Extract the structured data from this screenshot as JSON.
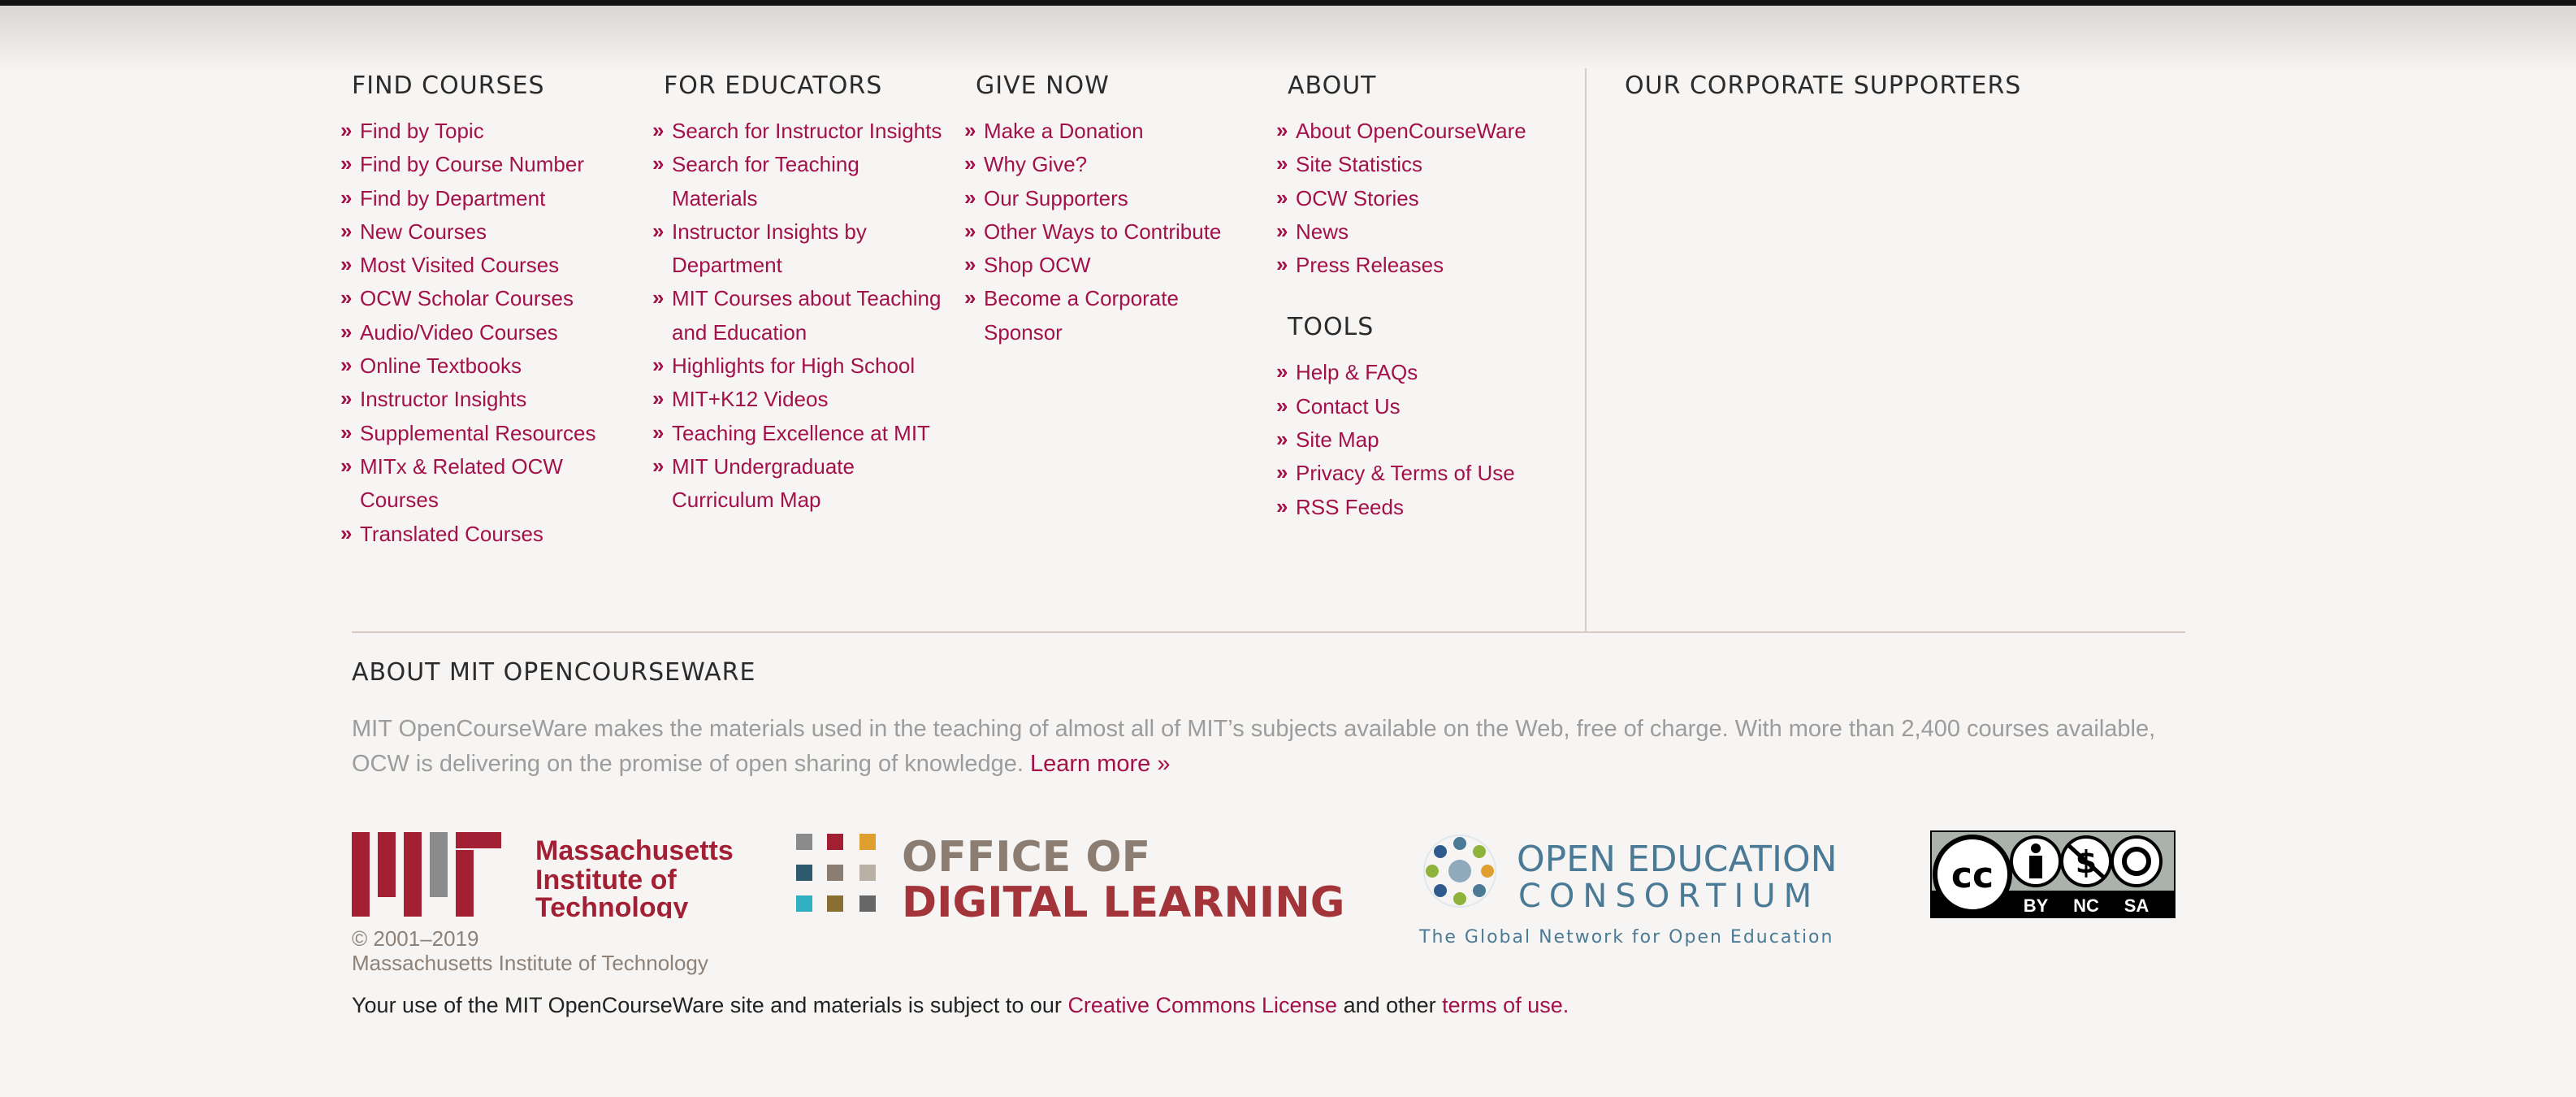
{
  "columns": {
    "find_courses": {
      "title": "FIND COURSES",
      "items": [
        "Find by Topic",
        "Find by Course Number",
        "Find by Department",
        "New Courses",
        "Most Visited Courses",
        "OCW Scholar Courses",
        "Audio/Video Courses",
        "Online Textbooks",
        "Instructor Insights",
        "Supplemental Resources",
        "MITx & Related OCW",
        "Courses",
        "Translated Courses"
      ]
    },
    "for_educators": {
      "title": "FOR EDUCATORS",
      "items": [
        "Search for Instructor Insights",
        "Search for Teaching",
        "Materials",
        "Instructor Insights by",
        "Department",
        "MIT Courses about Teaching",
        "and Education",
        "Highlights for High School",
        "MIT+K12 Videos",
        "Teaching Excellence at MIT",
        "MIT Undergraduate",
        "Curriculum Map"
      ]
    },
    "give_now": {
      "title": "GIVE NOW",
      "items": [
        "Make a Donation",
        "Why Give?",
        "Our Supporters",
        "Other Ways to Contribute",
        "Shop OCW",
        "Become a Corporate",
        "Sponsor"
      ]
    },
    "about": {
      "title": "ABOUT",
      "items": [
        "About OpenCourseWare",
        "Site Statistics",
        "OCW Stories",
        "News",
        "Press Releases"
      ]
    },
    "tools": {
      "title": "TOOLS",
      "items": [
        "Help & FAQs",
        "Contact Us",
        "Site Map",
        "Privacy & Terms of Use",
        "RSS Feeds"
      ]
    }
  },
  "corporate": {
    "title": "OUR CORPORATE SUPPORTERS"
  },
  "about_section": {
    "title": "ABOUT MIT OPENCOURSEWARE",
    "text": "MIT OpenCourseWare makes the materials used in the teaching of almost all of MIT’s subjects available on the Web, free of charge. With more than 2,400 courses available, OCW is delivering on the promise of open sharing of knowledge. ",
    "learn_more": "Learn more »"
  },
  "logos": {
    "mit": {
      "line1": "Massachusetts",
      "line2": "Institute of",
      "line3": "Technology"
    },
    "odl": {
      "line1": "OFFICE OF",
      "line2": "DIGITAL LEARNING"
    },
    "oec": {
      "line1": "OPEN EDUCATION",
      "line2": "CONSORTIUM",
      "tagline": "The Global Network for Open Education"
    },
    "cc": {
      "by": "BY",
      "nc": "NC",
      "sa": "SA"
    }
  },
  "copyright": {
    "years": "© 2001–2019",
    "org": "Massachusetts Institute of Technology"
  },
  "terms": {
    "prefix": "Your use of the MIT OpenCourseWare site and materials is subject to our ",
    "license": "Creative Commons License",
    "middle": " and other ",
    "terms_link": "terms of use",
    "suffix": "."
  },
  "colors": {
    "accent": "#a3114a",
    "mit_red": "#a31f34",
    "odl_grey": "#8b7d72",
    "oec_blue": "#4a7a96"
  }
}
